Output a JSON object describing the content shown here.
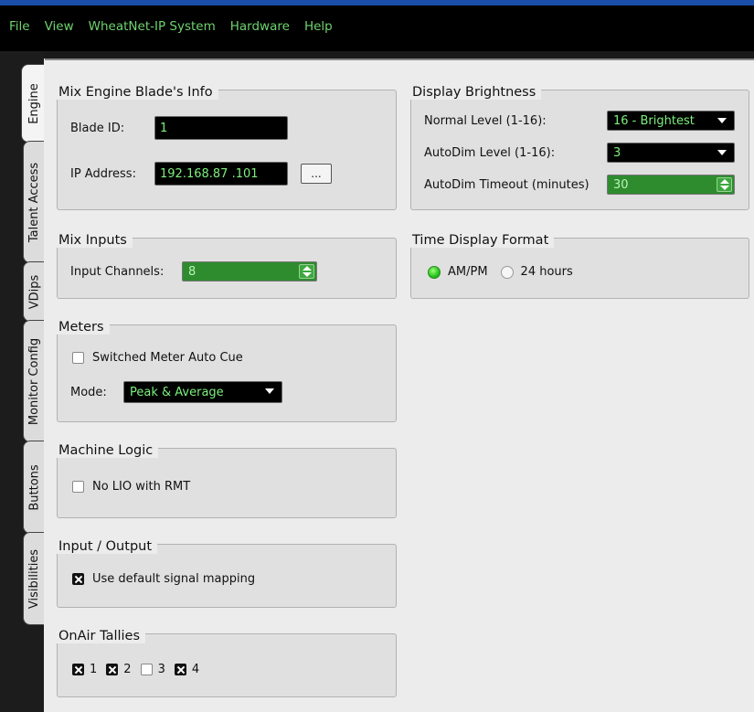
{
  "menu": [
    "File",
    "View",
    "WheatNet-IP System",
    "Hardware",
    "Help"
  ],
  "tabs": [
    {
      "label": "Engine",
      "active": true
    },
    {
      "label": "Talent Access",
      "active": false
    },
    {
      "label": "VDips",
      "active": false
    },
    {
      "label": "Monitor Config",
      "active": false
    },
    {
      "label": "Buttons",
      "active": false
    },
    {
      "label": "Visibilities",
      "active": false
    }
  ],
  "blade_info": {
    "title": "Mix Engine Blade's Info",
    "blade_id_label": "Blade ID:",
    "blade_id": "1",
    "ip_label": "IP Address:",
    "ip": "192.168.87 .101",
    "browse_label": "..."
  },
  "mix_inputs": {
    "title": "Mix Inputs",
    "channels_label": "Input Channels:",
    "channels": "8"
  },
  "meters": {
    "title": "Meters",
    "auto_cue_label": "Switched Meter Auto Cue",
    "auto_cue_checked": false,
    "mode_label": "Mode:",
    "mode": "Peak & Average"
  },
  "machine_logic": {
    "title": "Machine Logic",
    "no_lio_label": "No LIO with RMT",
    "no_lio_checked": false
  },
  "io": {
    "title": "Input / Output",
    "default_mapping_label": "Use default signal mapping",
    "default_mapping_checked": true
  },
  "tallies": {
    "title": "OnAir Tallies",
    "items": [
      {
        "label": "1",
        "checked": true
      },
      {
        "label": "2",
        "checked": true
      },
      {
        "label": "3",
        "checked": false
      },
      {
        "label": "4",
        "checked": true
      }
    ]
  },
  "brightness": {
    "title": "Display Brightness",
    "normal_label": "Normal Level (1-16):",
    "normal": "16 - Brightest",
    "autodim_label": "AutoDim Level (1-16):",
    "autodim": "3",
    "timeout_label": "AutoDim Timeout (minutes)",
    "timeout": "30"
  },
  "time_format": {
    "title": "Time Display Format",
    "options": [
      {
        "label": "AM/PM",
        "selected": true
      },
      {
        "label": "24 hours",
        "selected": false
      }
    ]
  },
  "colors": {
    "menu_text": "#6fd36f",
    "field_text": "#7df07d",
    "spin_bg": "#2e8b2e"
  }
}
